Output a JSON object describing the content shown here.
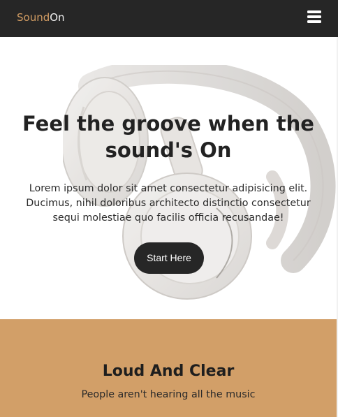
{
  "navbar": {
    "brand_part1": "Sound",
    "brand_part2": "On",
    "menu_icon": "hamburger-menu-icon"
  },
  "hero": {
    "title": "Feel the groove when the sound's On",
    "text": "Lorem ipsum dolor sit amet consectetur adipisicing elit. Ducimus, nihil doloribus architecto distinctio consectetur sequi molestiae quo facilis officia recusandae!",
    "cta_label": "Start Here",
    "image": "headphones-image"
  },
  "section2": {
    "title": "Loud And Clear",
    "subtitle": "People aren't hearing all the music"
  },
  "colors": {
    "navbar_bg": "#262626",
    "brand_accent": "#d39d63",
    "section2_bg": "#d29f68",
    "button_bg": "#262626"
  }
}
